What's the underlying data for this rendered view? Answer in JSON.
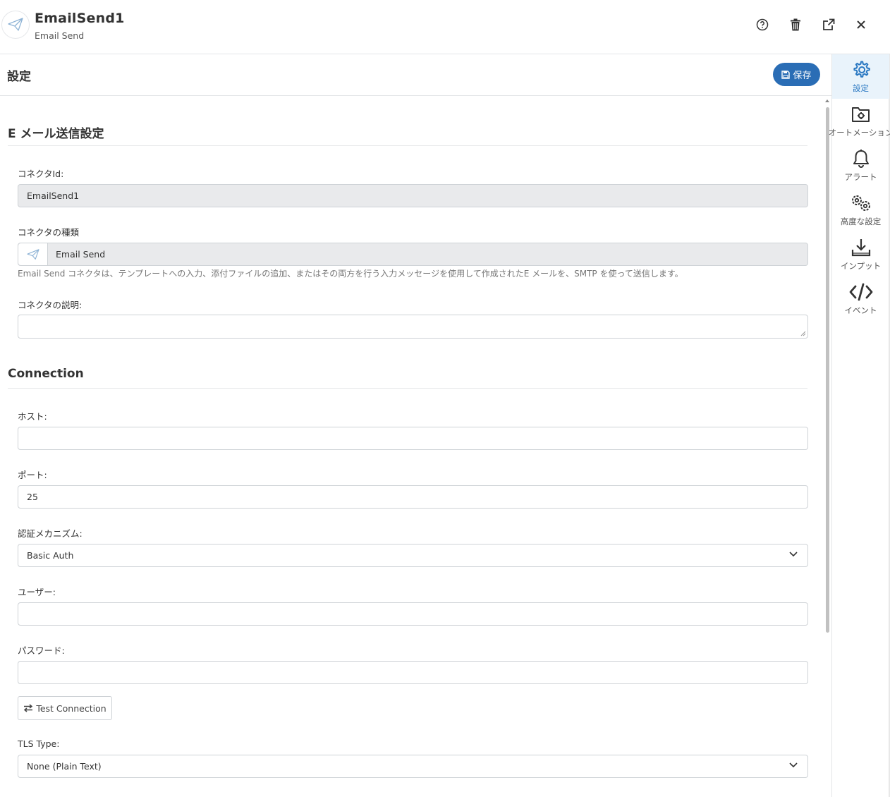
{
  "header": {
    "title": "EmailSend1",
    "subtitle": "Email Send"
  },
  "main": {
    "title": "設定",
    "save_label": "保存"
  },
  "email_section": {
    "title": "E メール送信設定",
    "connector_id_label": "コネクタId:",
    "connector_id_value": "EmailSend1",
    "connector_type_label": "コネクタの種類",
    "connector_type_value": "Email Send",
    "connector_type_description": "Email Send コネクタは、テンプレートへの入力、添付ファイルの追加、またはその両方を行う入力メッセージを使用して作成されたE メールを、SMTP を使って送信します。",
    "connector_desc_label": "コネクタの説明:",
    "connector_desc_value": ""
  },
  "connection_section": {
    "title": "Connection",
    "host_label": "ホスト:",
    "host_value": "",
    "port_label": "ポート:",
    "port_value": "25",
    "auth_label": "認証メカニズム:",
    "auth_value": "Basic Auth",
    "user_label": "ユーザー:",
    "user_value": "",
    "password_label": "パスワード:",
    "password_value": "",
    "test_connection_label": "Test Connection",
    "tls_label": "TLS Type:",
    "tls_value": "None (Plain Text)"
  },
  "rightnav": {
    "items": [
      {
        "label": "設定",
        "icon": "gear-icon",
        "active": true
      },
      {
        "label": "オートメーション",
        "icon": "folder-gear-icon",
        "active": false
      },
      {
        "label": "アラート",
        "icon": "bell-icon",
        "active": false
      },
      {
        "label": "高度な設定",
        "icon": "gears-icon",
        "active": false
      },
      {
        "label": "インプット",
        "icon": "download-icon",
        "active": false
      },
      {
        "label": "イベント",
        "icon": "code-icon",
        "active": false
      }
    ]
  },
  "colors": {
    "accent": "#2a6db5",
    "active_nav_bg": "#e9f3fb",
    "disabled_input_bg": "#e9eaec"
  }
}
